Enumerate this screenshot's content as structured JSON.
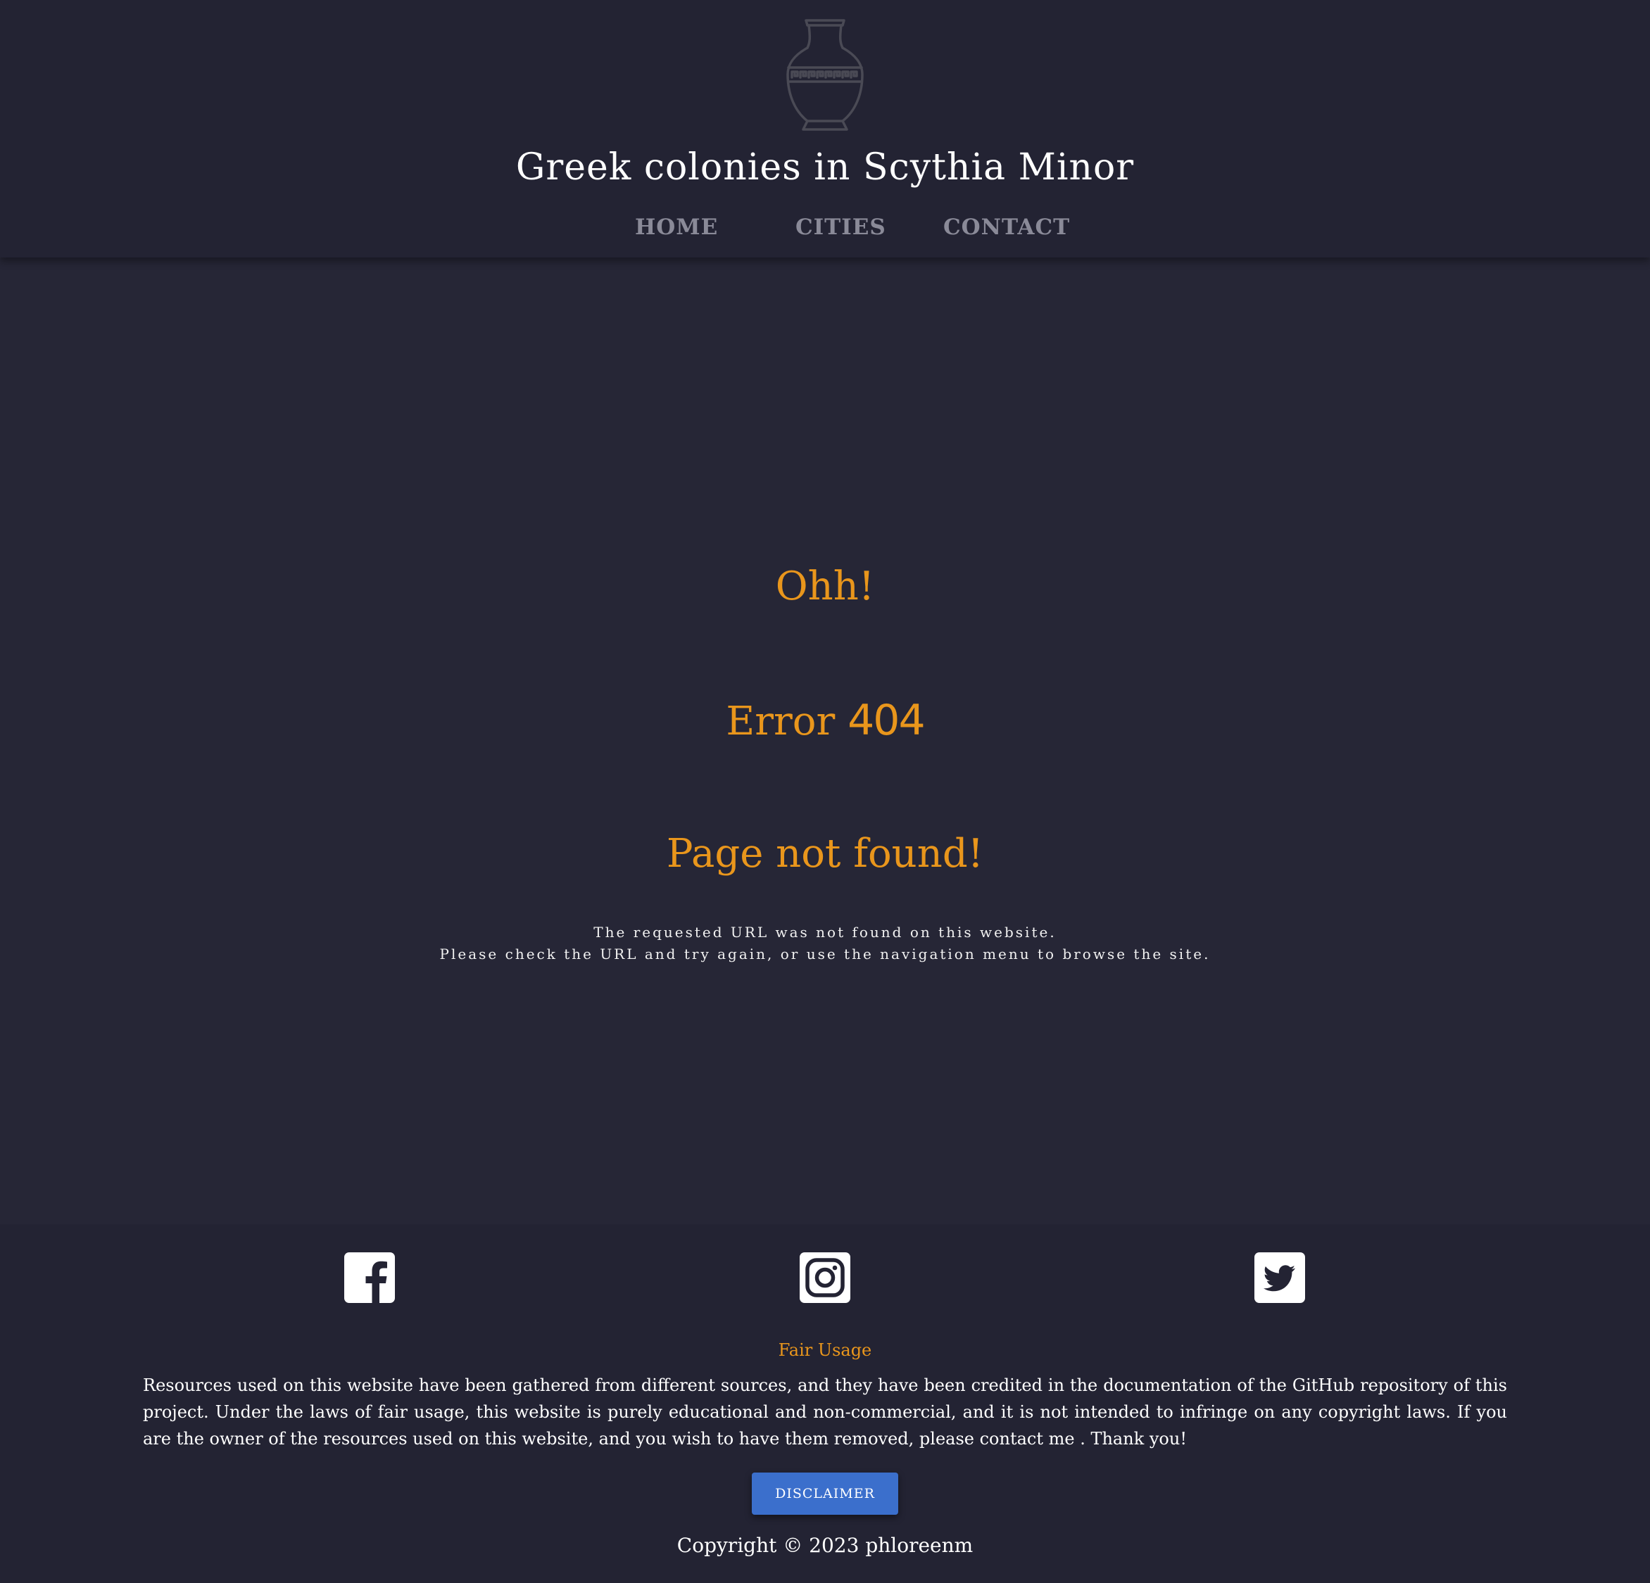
{
  "header": {
    "logo_icon": "greek-amphora-icon",
    "title": "Greek colonies in Scythia Minor",
    "nav": {
      "home": "HOME",
      "cities": "CITIES",
      "contact": "CONTACT"
    }
  },
  "main": {
    "exclamation": "Ohh!",
    "error_word": "Error",
    "error_code": "404",
    "heading": "Page not found!",
    "message_line1": "The requested URL was not found on this website.",
    "message_line2": "Please check the URL and try again, or use the navigation menu to browse the site."
  },
  "footer": {
    "social_icons": [
      "facebook-icon",
      "instagram-icon",
      "twitter-icon"
    ],
    "fair_title": "Fair Usage",
    "fair_text": "Resources used on this website have been gathered from different sources, and they have been credited in the documentation of the GitHub repository of this project. Under the laws of fair usage, this website is purely educational and non-commercial, and it is not intended to infringe on any copyright laws. If you are the owner of the resources used on this website, and you wish to have them removed, please contact me . Thank you!",
    "disclaimer_label": "DISCLAIMER",
    "copyright": "Copyright © 2023 phloreenm"
  },
  "colors": {
    "background": "#262636",
    "header_bg": "#232333",
    "accent": "#e9961c",
    "nav_text": "#8a8a98",
    "button": "#3b6fcc"
  }
}
